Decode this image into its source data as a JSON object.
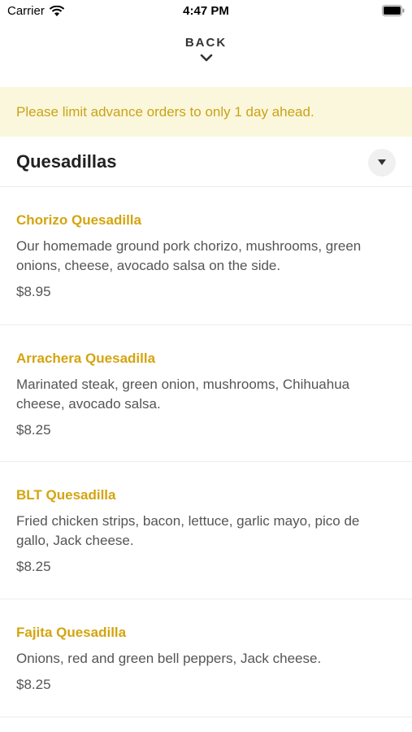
{
  "status_bar": {
    "carrier": "Carrier",
    "time": "4:47 PM"
  },
  "nav": {
    "back_label": "BACK"
  },
  "notice": {
    "text": "Please limit advance orders to only 1 day ahead."
  },
  "category": {
    "title": "Quesadillas"
  },
  "items": [
    {
      "name": "Chorizo Quesadilla",
      "description": "Our homemade ground pork chorizo, mushrooms, green onions, cheese, avocado salsa on the side.",
      "price": "$8.95"
    },
    {
      "name": "Arrachera Quesadilla",
      "description": "Marinated steak, green onion, mushrooms, Chihuahua cheese, avocado salsa.",
      "price": "$8.25"
    },
    {
      "name": "BLT Quesadilla",
      "description": "Fried chicken strips, bacon, lettuce, garlic mayo, pico de gallo, Jack cheese.",
      "price": "$8.25"
    },
    {
      "name": "Fajita Quesadilla",
      "description": "Onions, red and green bell peppers, Jack cheese.",
      "price": "$8.25"
    }
  ],
  "colors": {
    "accent": "#d4a40f",
    "notice_bg": "#fbf7dc",
    "notice_text": "#c9a318"
  }
}
